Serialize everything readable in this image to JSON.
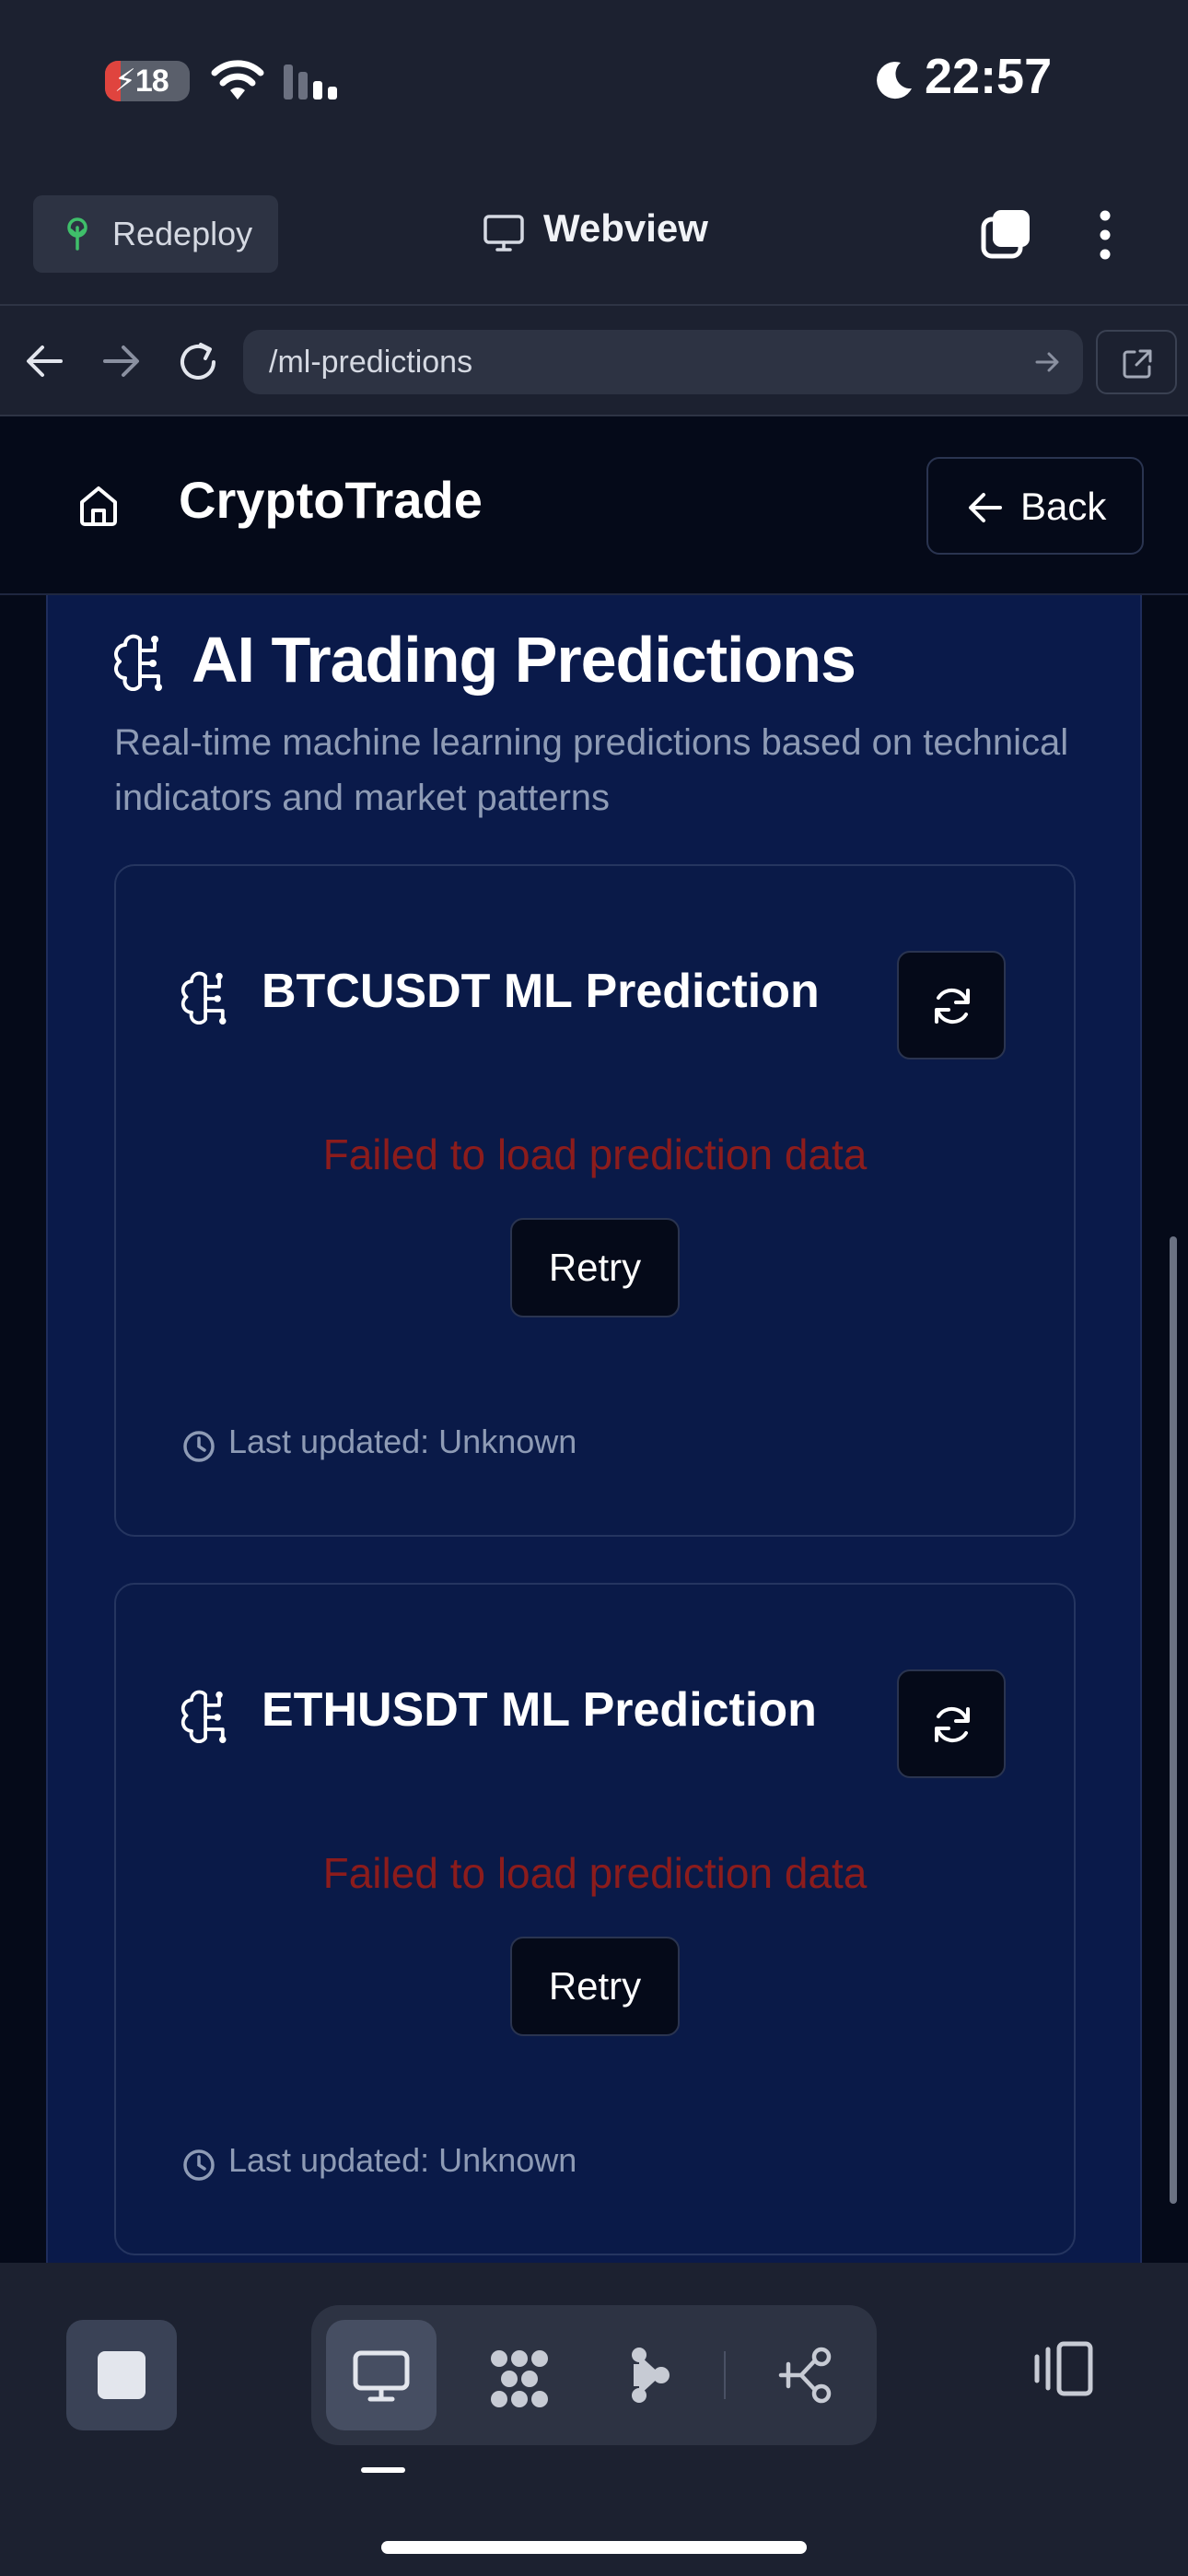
{
  "status_bar": {
    "battery_level": "18",
    "battery_fraction": 0.18,
    "time": "22:57"
  },
  "app_bar": {
    "redeploy_label": "Redeploy",
    "view_label": "Webview"
  },
  "browser": {
    "url": "/ml-predictions"
  },
  "site": {
    "title": "CryptoTrade",
    "back_label": "Back"
  },
  "panel": {
    "title": "AI Trading Predictions",
    "description": "Real-time machine learning predictions based on technical indicators and market patterns"
  },
  "cards": [
    {
      "title": "BTCUSDT ML Prediction",
      "error": "Failed to load prediction data",
      "retry_label": "Retry",
      "updated": "Last updated: Unknown"
    },
    {
      "title": "ETHUSDT ML Prediction",
      "error": "Failed to load prediction data",
      "retry_label": "Retry",
      "updated": "Last updated: Unknown"
    }
  ],
  "colors": {
    "page_background": "#050a19",
    "panel_background": "#0a1a4a",
    "error_text": "#8c1c1c",
    "muted_text": "#8e9bb5",
    "redeploy_accent": "#3fbf6a"
  },
  "icons": {
    "battery": "battery-charging-icon",
    "wifi": "wifi-icon",
    "signal": "cellular-signal-icon",
    "moon": "moon-icon",
    "redeploy": "tree-icon",
    "webview": "monitor-icon",
    "tabs": "tabs-icon",
    "more": "more-vertical-icon",
    "home": "home-icon",
    "brain": "brain-icon",
    "refresh": "refresh-icon",
    "clock": "clock-icon"
  }
}
